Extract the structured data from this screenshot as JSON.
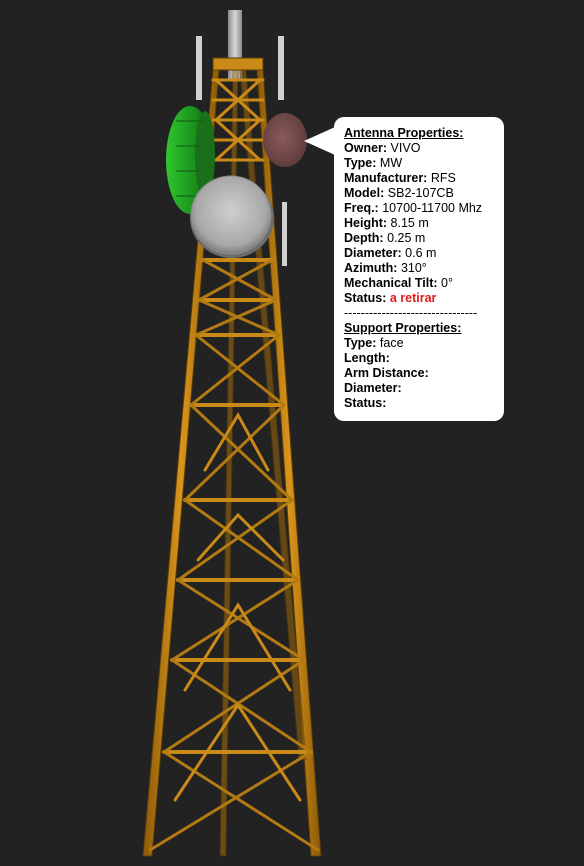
{
  "tooltip": {
    "antenna_title": "Antenna Properties:",
    "antenna": [
      {
        "label": "Owner:",
        "value": "VIVO"
      },
      {
        "label": "Type:",
        "value": "MW"
      },
      {
        "label": "Manufacturer:",
        "value": "RFS"
      },
      {
        "label": "Model:",
        "value": "SB2-107CB"
      },
      {
        "label": "Freq.:",
        "value": "10700-11700 Mhz"
      },
      {
        "label": "Height:",
        "value": "8.15 m"
      },
      {
        "label": "Depth:",
        "value": "0.25 m"
      },
      {
        "label": "Diameter:",
        "value": "0.6 m"
      },
      {
        "label": "Azimuth:",
        "value": "310°"
      },
      {
        "label": "Mechanical Tilt:",
        "value": "0°"
      }
    ],
    "status_label": "Status:",
    "status_value": "a retirar",
    "status_color": "#e31b1b",
    "separator": "--------------------------------",
    "support_title": "Support Properties:",
    "support": [
      {
        "label": "Type:",
        "value": "face"
      },
      {
        "label": "Length:",
        "value": ""
      },
      {
        "label": "Arm Distance:",
        "value": ""
      },
      {
        "label": "Diameter:",
        "value": ""
      },
      {
        "label": "Status:",
        "value": ""
      }
    ]
  },
  "scene": {
    "background_color": "#222222",
    "tower_color": "#c98a17",
    "green_dish_color": "#1f9e1f",
    "grey_dish_color": "#b5b5b5",
    "brown_dish_color": "#7a5050"
  }
}
